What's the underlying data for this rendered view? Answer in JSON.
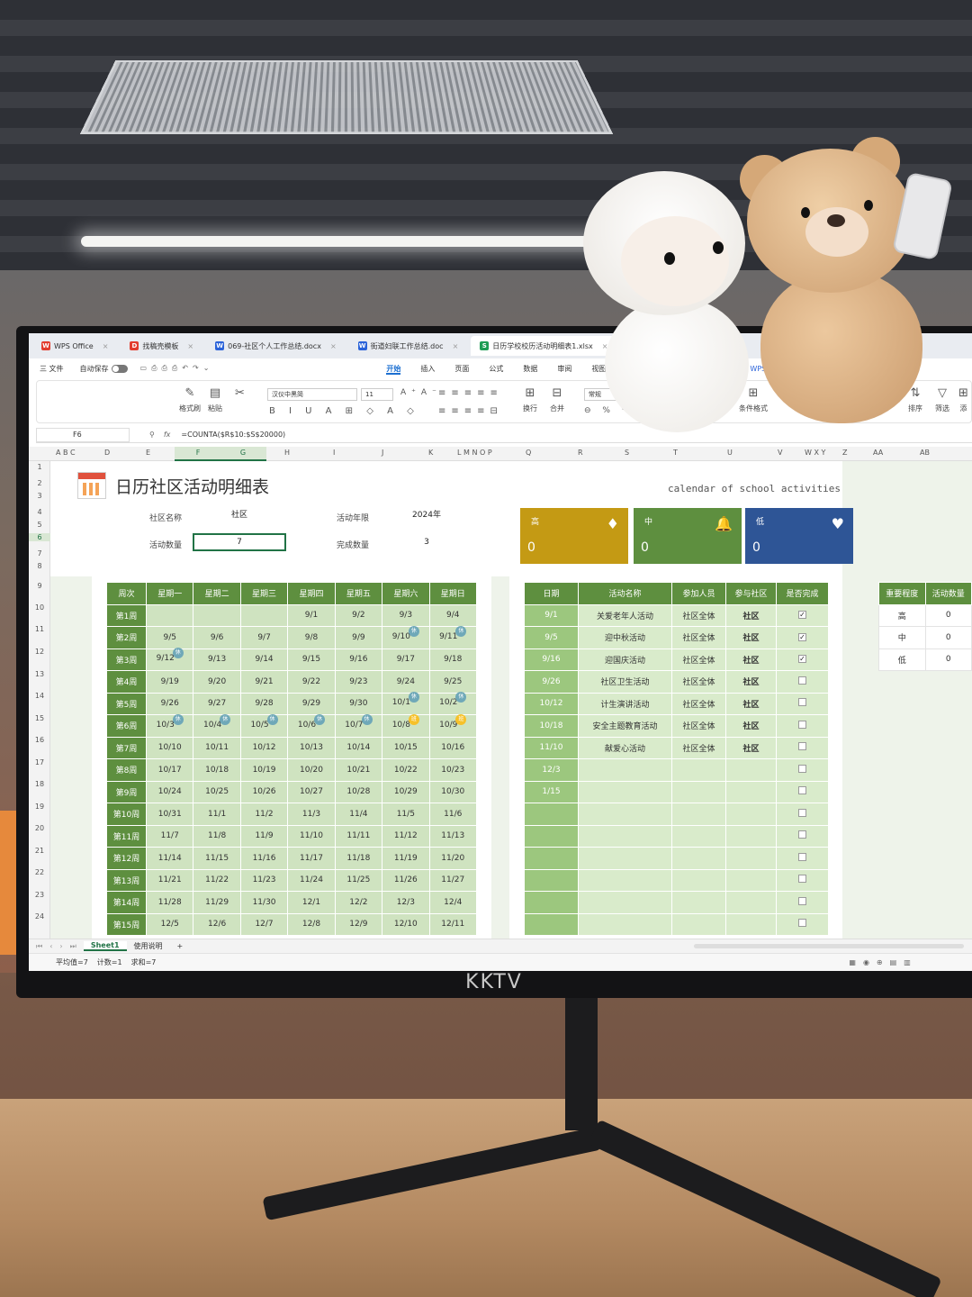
{
  "tabs": [
    {
      "icon": "W",
      "label": "WPS Office",
      "color": "#e23d2e"
    },
    {
      "icon": "D",
      "label": "找稿壳模板",
      "color": "#e23d2e"
    },
    {
      "icon": "W",
      "label": "069-社区个人工作总结.docx",
      "color": "#2b63d9"
    },
    {
      "icon": "W",
      "label": "街道妇联工作总结.doc",
      "color": "#2b63d9"
    },
    {
      "icon": "S",
      "label": "日历学校校历活动明细表1.xlsx",
      "color": "#1f9d55"
    }
  ],
  "menu": {
    "file": "三 文件",
    "autosave": "自动保存",
    "items": [
      "开始",
      "插入",
      "页面",
      "公式",
      "数据",
      "审阅",
      "视图"
    ],
    "active": "开始",
    "wps_ai": "WPS A"
  },
  "ribbon": {
    "format_painter": "格式刷",
    "paste": "粘贴",
    "font_name": "汉仪中黑简",
    "font_size": "11",
    "wrap": "换行",
    "merge": "合并",
    "number_format": "常规",
    "cond_format": "条件格式",
    "sort": "排序",
    "filter": "筛选",
    "add": "添"
  },
  "formula_bar": {
    "cell": "F6",
    "fx": "fx",
    "formula": "=COUNTA($R$10:$S$20000)"
  },
  "columns": [
    "A B C",
    "D",
    "E",
    "F",
    "G",
    "H",
    "I",
    "J",
    "K",
    "L M N O P",
    "Q",
    "R",
    "S",
    "T",
    "U",
    "V",
    "W X Y",
    "Z",
    "AA",
    "AB"
  ],
  "rows": [
    "1",
    "2",
    "3",
    "4",
    "5",
    "6",
    "7",
    "8",
    "9",
    "10",
    "11",
    "12",
    "13",
    "14",
    "15",
    "16",
    "17",
    "18",
    "19",
    "20",
    "21",
    "22",
    "23",
    "24"
  ],
  "sheet": {
    "title": "日历社区活动明细表",
    "subtitle": "calendar of school activities",
    "community_label": "社区名称",
    "community_value": "社区",
    "year_label": "活动年限",
    "year_value": "2024年",
    "count_label": "活动数量",
    "count_value": "7",
    "done_label": "完成数量",
    "done_value": "3"
  },
  "kpis": [
    {
      "label": "高",
      "value": "0",
      "icon": "diamond-icon",
      "color": "#c49a14"
    },
    {
      "label": "中",
      "value": "0",
      "icon": "bell-icon",
      "color": "#5e8f3f"
    },
    {
      "label": "低",
      "value": "0",
      "icon": "heart-icon",
      "color": "#2e5596"
    }
  ],
  "calendar": {
    "headers": [
      "周次",
      "星期一",
      "星期二",
      "星期三",
      "星期四",
      "星期五",
      "星期六",
      "星期日"
    ],
    "rows": [
      [
        "第1周",
        "",
        "",
        "",
        "9/1",
        "9/2",
        "9/3",
        "9/4"
      ],
      [
        "第2周",
        "9/5",
        "9/6",
        "9/7",
        "9/8",
        "9/9",
        "9/10",
        "9/11"
      ],
      [
        "第3周",
        "9/12",
        "9/13",
        "9/14",
        "9/15",
        "9/16",
        "9/17",
        "9/18"
      ],
      [
        "第4周",
        "9/19",
        "9/20",
        "9/21",
        "9/22",
        "9/23",
        "9/24",
        "9/25"
      ],
      [
        "第5周",
        "9/26",
        "9/27",
        "9/28",
        "9/29",
        "9/30",
        "10/1",
        "10/2"
      ],
      [
        "第6周",
        "10/3",
        "10/4",
        "10/5",
        "10/6",
        "10/7",
        "10/8",
        "10/9"
      ],
      [
        "第7周",
        "10/10",
        "10/11",
        "10/12",
        "10/13",
        "10/14",
        "10/15",
        "10/16"
      ],
      [
        "第8周",
        "10/17",
        "10/18",
        "10/19",
        "10/20",
        "10/21",
        "10/22",
        "10/23"
      ],
      [
        "第9周",
        "10/24",
        "10/25",
        "10/26",
        "10/27",
        "10/28",
        "10/29",
        "10/30"
      ],
      [
        "第10周",
        "10/31",
        "11/1",
        "11/2",
        "11/3",
        "11/4",
        "11/5",
        "11/6"
      ],
      [
        "第11周",
        "11/7",
        "11/8",
        "11/9",
        "11/10",
        "11/11",
        "11/12",
        "11/13"
      ],
      [
        "第12周",
        "11/14",
        "11/15",
        "11/16",
        "11/17",
        "11/18",
        "11/19",
        "11/20"
      ],
      [
        "第13周",
        "11/21",
        "11/22",
        "11/23",
        "11/24",
        "11/25",
        "11/26",
        "11/27"
      ],
      [
        "第14周",
        "11/28",
        "11/29",
        "11/30",
        "12/1",
        "12/2",
        "12/3",
        "12/4"
      ],
      [
        "第15周",
        "12/5",
        "12/6",
        "12/7",
        "12/8",
        "12/9",
        "12/10",
        "12/11"
      ]
    ],
    "rest_badge": "休",
    "rest_cells": [
      "9/10",
      "9/11",
      "9/12",
      "10/1",
      "10/2",
      "10/3",
      "10/4",
      "10/5",
      "10/6",
      "10/7"
    ],
    "holiday_badge": "班",
    "holiday_cells": [
      "10/8",
      "10/9"
    ]
  },
  "activities": {
    "headers": [
      "日期",
      "活动名称",
      "参加人员",
      "参与社区",
      "是否完成"
    ],
    "rows": [
      {
        "date": "9/1",
        "name": "关爱老年人活动",
        "people": "社区全体",
        "community": "社区",
        "done": true
      },
      {
        "date": "9/5",
        "name": "迎中秋活动",
        "people": "社区全体",
        "community": "社区",
        "done": true
      },
      {
        "date": "9/16",
        "name": "迎国庆活动",
        "people": "社区全体",
        "community": "社区",
        "done": true
      },
      {
        "date": "9/26",
        "name": "社区卫生活动",
        "people": "社区全体",
        "community": "社区",
        "done": false
      },
      {
        "date": "10/12",
        "name": "计生演讲活动",
        "people": "社区全体",
        "community": "社区",
        "done": false
      },
      {
        "date": "10/18",
        "name": "安全主题教育活动",
        "people": "社区全体",
        "community": "社区",
        "done": false
      },
      {
        "date": "11/10",
        "name": "献爱心活动",
        "people": "社区全体",
        "community": "社区",
        "done": false
      },
      {
        "date": "12/3",
        "name": "",
        "people": "",
        "community": "",
        "done": false
      },
      {
        "date": "1/15",
        "name": "",
        "people": "",
        "community": "",
        "done": false
      },
      {
        "date": "",
        "name": "",
        "people": "",
        "community": "",
        "done": false
      },
      {
        "date": "",
        "name": "",
        "people": "",
        "community": "",
        "done": false
      },
      {
        "date": "",
        "name": "",
        "people": "",
        "community": "",
        "done": false
      },
      {
        "date": "",
        "name": "",
        "people": "",
        "community": "",
        "done": false
      },
      {
        "date": "",
        "name": "",
        "people": "",
        "community": "",
        "done": false
      },
      {
        "date": "",
        "name": "",
        "people": "",
        "community": "",
        "done": false
      }
    ],
    "check_mark": "☑"
  },
  "summary": {
    "headers": [
      "重要程度",
      "活动数量"
    ],
    "rows": [
      [
        "高",
        "0"
      ],
      [
        "中",
        "0"
      ],
      [
        "低",
        "0"
      ]
    ]
  },
  "sheet_tabs": [
    "Sheet1",
    "使用说明",
    "+"
  ],
  "status": {
    "avg": "平均值=7",
    "count": "计数=1",
    "sum": "求和=7"
  },
  "monitor_brand": "KKTV",
  "colors": {
    "header_green": "#5e8f3f",
    "cell_green": "#cfe3c0",
    "selection": "#217346"
  }
}
